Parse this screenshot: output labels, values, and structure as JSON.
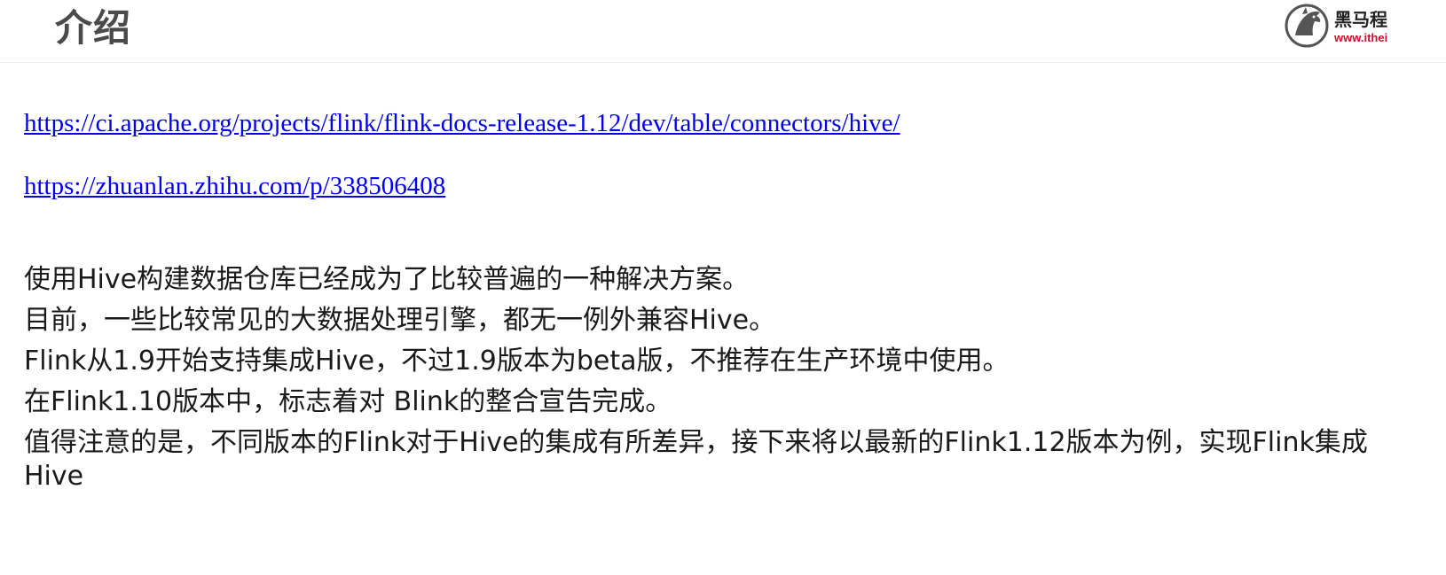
{
  "header": {
    "title": "介绍",
    "logo": {
      "icon": "horse-head-logo-icon",
      "name": "黑马程",
      "url": "www.ithei"
    }
  },
  "links": [
    "https://ci.apache.org/projects/flink/flink-docs-release-1.12/dev/table/connectors/hive/",
    "https://zhuanlan.zhihu.com/p/338506408"
  ],
  "paragraphs": [
    "使用Hive构建数据仓库已经成为了比较普遍的一种解决方案。",
    "目前，一些比较常见的大数据处理引擎，都无一例外兼容Hive。",
    "Flink从1.9开始支持集成Hive，不过1.9版本为beta版，不推荐在生产环境中使用。",
    "在Flink1.10版本中，标志着对 Blink的整合宣告完成。",
    "值得注意的是，不同版本的Flink对于Hive的集成有所差异，接下来将以最新的Flink1.12版本为例，实现Flink集成Hive"
  ],
  "colors": {
    "link": "#0000ee",
    "title": "#4a4a4a",
    "logo_url": "#c8102e",
    "text": "#1a1a1a"
  }
}
